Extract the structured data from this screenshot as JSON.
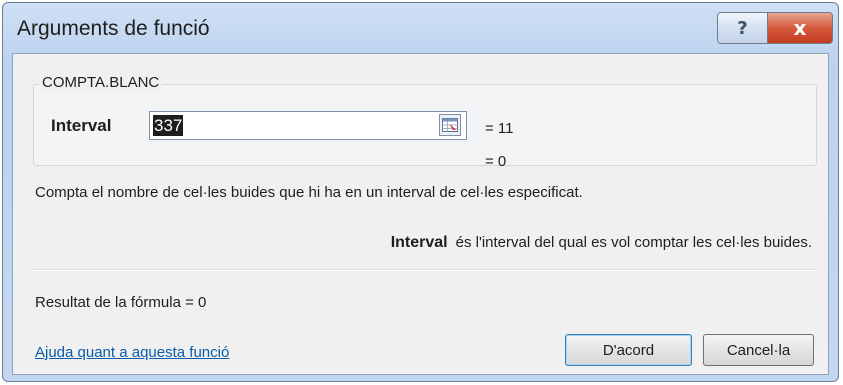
{
  "window": {
    "title": "Arguments de funció",
    "help_label": "?",
    "close_label": "x"
  },
  "function": {
    "name": "COMPTA.BLANC",
    "argument_label": "Interval",
    "argument_value": "337",
    "argument_result": "= 11",
    "function_result": "= 0",
    "description": "Compta el nombre de cel·les buides que hi ha en un interval de cel·les especificat.",
    "param_name": "Interval",
    "param_description": "és l'interval del qual es vol comptar les cel·les buides."
  },
  "footer": {
    "formula_result": "Resultat de la fórmula =  0",
    "help_link": "Ajuda quant a aquesta funció",
    "ok_label": "D'acord",
    "cancel_label": "Cancel·la"
  }
}
